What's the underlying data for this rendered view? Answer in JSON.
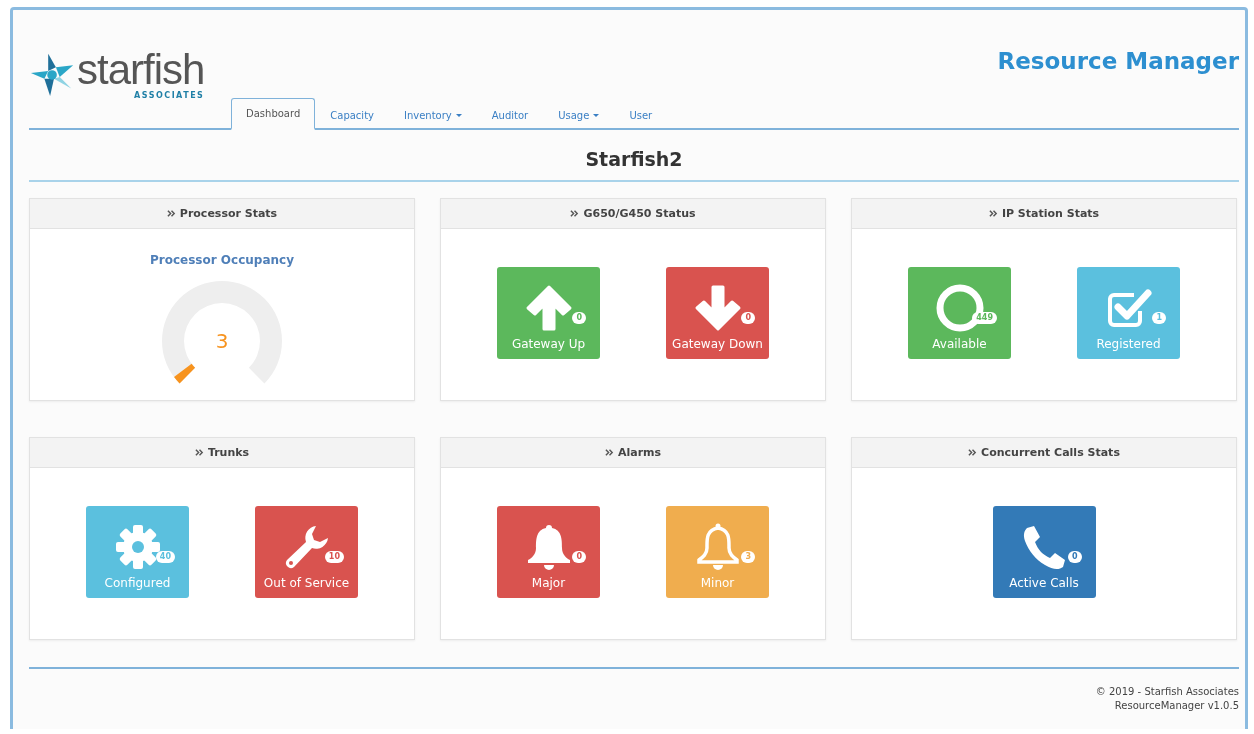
{
  "header": {
    "logo": {
      "name": "starfish",
      "tagline": "ASSOCIATES"
    },
    "title": "Resource Manager"
  },
  "tabs": [
    {
      "label": "Dashboard",
      "selected": true,
      "dropdown": false
    },
    {
      "label": "Capacity",
      "selected": false,
      "dropdown": false
    },
    {
      "label": "Inventory",
      "selected": false,
      "dropdown": true
    },
    {
      "label": "Auditor",
      "selected": false,
      "dropdown": false
    },
    {
      "label": "Usage",
      "selected": false,
      "dropdown": true
    },
    {
      "label": "User",
      "selected": false,
      "dropdown": false
    }
  ],
  "page_title": "Starfish2",
  "panels": [
    {
      "title": "Processor Stats",
      "kind": "gauge",
      "gauge": {
        "label": "Processor Occupancy",
        "value": "3"
      }
    },
    {
      "title": "G650/G450 Status",
      "kind": "tiles",
      "tiles": [
        {
          "kind": "arrow-up",
          "label": "Gateway Up",
          "count": "0",
          "color": "#5cb85c"
        },
        {
          "kind": "arrow-down",
          "label": "Gateway Down",
          "count": "0",
          "color": "#d9534f"
        }
      ]
    },
    {
      "title": "IP Station Stats",
      "kind": "tiles",
      "tiles": [
        {
          "kind": "circle",
          "label": "Available",
          "count": "449",
          "color": "#5cb85c"
        },
        {
          "kind": "check",
          "label": "Registered",
          "count": "1",
          "color": "#5bc0de"
        }
      ]
    },
    {
      "title": "Trunks",
      "kind": "tiles",
      "tiles": [
        {
          "kind": "gear",
          "label": "Configured",
          "count": "40",
          "color": "#5bc0de"
        },
        {
          "kind": "wrench",
          "label": "Out of Service",
          "count": "10",
          "color": "#d9534f"
        }
      ]
    },
    {
      "title": "Alarms",
      "kind": "tiles",
      "tiles": [
        {
          "kind": "bell",
          "label": "Major",
          "count": "0",
          "color": "#d9534f"
        },
        {
          "kind": "bell-outline",
          "label": "Minor",
          "count": "3",
          "color": "#f0ad4e"
        }
      ]
    },
    {
      "title": "Concurrent Calls Stats",
      "kind": "tiles",
      "tiles": [
        {
          "kind": "phone",
          "label": "Active Calls",
          "count": "0",
          "color": "#337ab7"
        }
      ]
    }
  ],
  "footer": {
    "copyright": "© 2019 - Starfish Associates",
    "version": "ResourceManager v1.0.5"
  }
}
